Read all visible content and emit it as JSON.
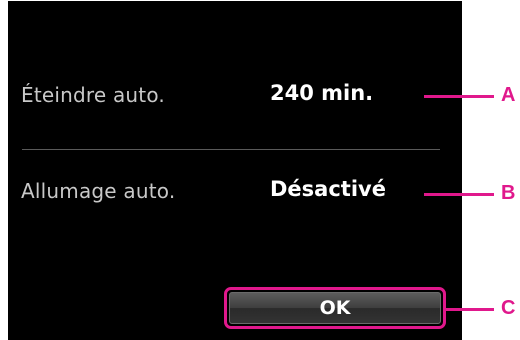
{
  "settings": [
    {
      "label": "Éteindre auto.",
      "value": "240 min."
    },
    {
      "label": "Allumage auto.",
      "value": "Désactivé"
    }
  ],
  "ok_button": {
    "label": "OK"
  },
  "callouts": {
    "a": "A",
    "b": "B",
    "c": "C"
  },
  "colors": {
    "screen_background": "#000000",
    "label_text": "#c8c8c8",
    "value_text": "#ffffff",
    "callout": "#e0188c",
    "selection_border": "#e0188c"
  }
}
